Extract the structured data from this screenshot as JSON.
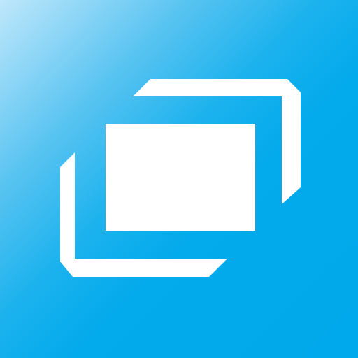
{
  "icon": {
    "name": "switch-windows-icon",
    "background_colors": [
      "#bfe7fb",
      "#00a9eb"
    ],
    "foreground_color": "#ffffff"
  }
}
